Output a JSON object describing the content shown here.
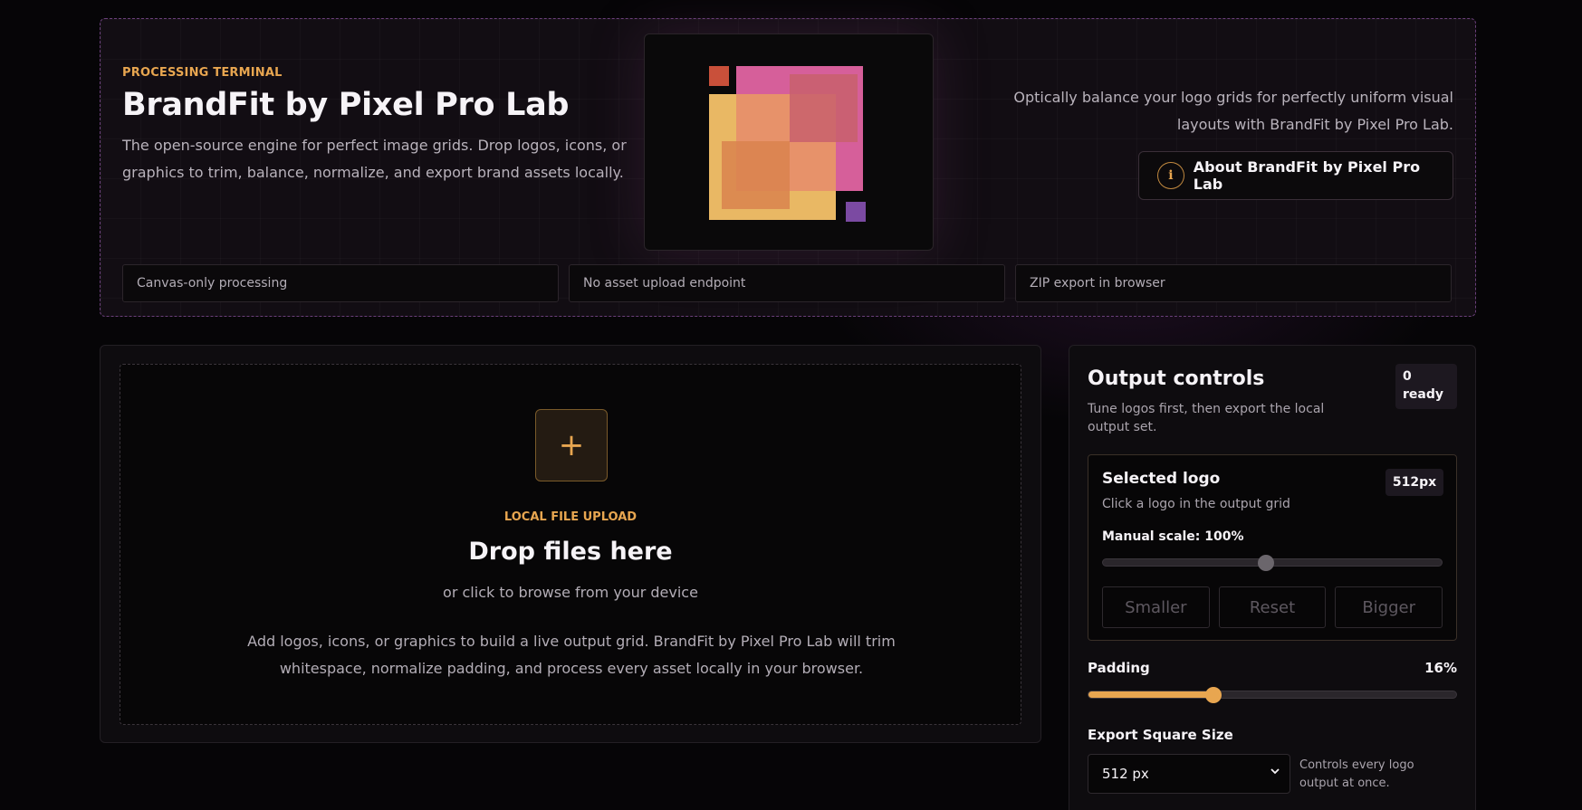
{
  "hero": {
    "eyebrow": "PROCESSING TERMINAL",
    "title": "BrandFit by Pixel Pro Lab",
    "description": "The open-source engine for perfect image grids. Drop logos, icons, or graphics to trim, balance, normalize, and export brand assets locally.",
    "tagline": "Optically balance your logo grids for perfectly uniform visual layouts with BrandFit by Pixel Pro Lab.",
    "about_button": "About BrandFit by Pixel Pro Lab",
    "about_icon_glyph": "i",
    "chips": [
      "Canvas-only processing",
      "No asset upload endpoint",
      "ZIP export in browser"
    ]
  },
  "upload": {
    "plus_glyph": "+",
    "eyebrow": "LOCAL FILE UPLOAD",
    "title": "Drop files here",
    "subtitle": "or click to browse from your device",
    "description": "Add logos, icons, or graphics to build a live output grid. BrandFit by Pixel Pro Lab will trim whitespace, normalize padding, and process every asset locally in your browser."
  },
  "controls": {
    "title": "Output controls",
    "description": "Tune logos first, then export the local output set.",
    "ready_badge": "0 ready",
    "selected": {
      "title": "Selected logo",
      "subtitle": "Click a logo in the output grid",
      "size_badge": "512px",
      "scale_label": "Manual scale: 100%",
      "scale_fraction": 0.48,
      "buttons": [
        "Smaller",
        "Reset",
        "Bigger"
      ]
    },
    "padding": {
      "label": "Padding",
      "value": "16%",
      "fraction": 0.34
    },
    "export": {
      "label": "Export Square Size",
      "selected": "512 px",
      "note": "Controls every logo output at once."
    }
  },
  "colors": {
    "accent": "#e8a650",
    "disabled_thumb": "#6b666c"
  }
}
